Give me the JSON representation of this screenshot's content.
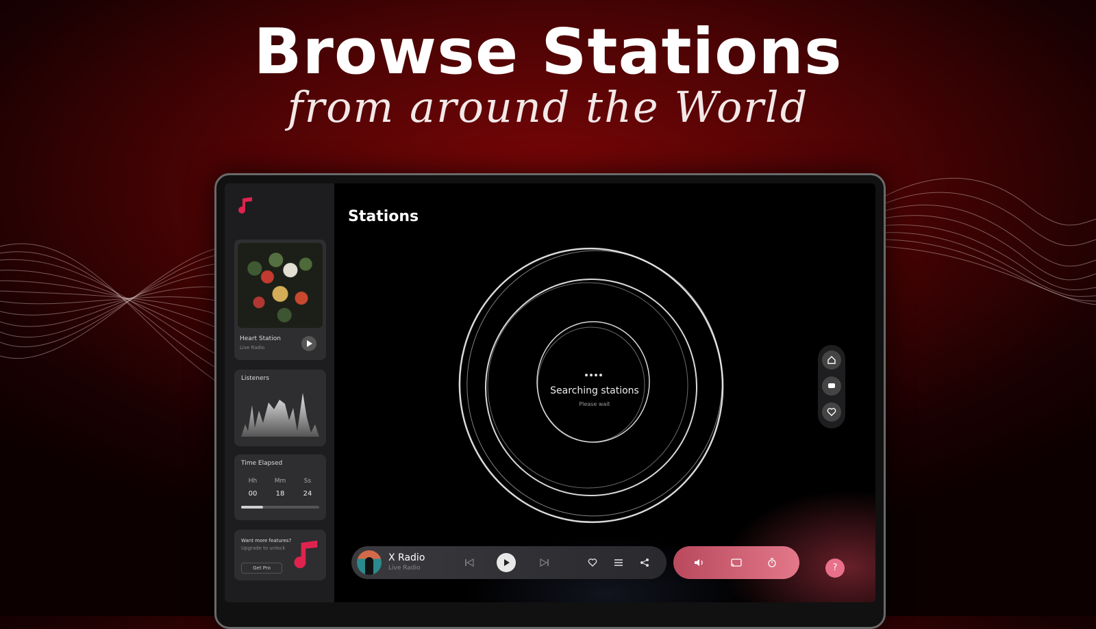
{
  "hero": {
    "title": "Browse Stations",
    "subtitle": "from around the World"
  },
  "app": {
    "page_title": "Stations",
    "now_playing_card": {
      "station": "Heart Station",
      "subtitle": "Live Radio"
    },
    "listeners_card": {
      "title": "Listeners"
    },
    "time_card": {
      "title": "Time Elapsed",
      "labels": [
        "Hh",
        "Mm",
        "Ss"
      ],
      "values": [
        "00",
        "18",
        "24"
      ],
      "progress": 0.28
    },
    "upgrade_card": {
      "title": "Want more features?",
      "subtitle": "Upgrade to unlock",
      "button": "Get Pro"
    },
    "search": {
      "title": "Searching stations",
      "subtitle": "Please wait"
    },
    "player": {
      "station": "X Radio",
      "subtitle": "Live Radio"
    },
    "help_label": "?",
    "colors": {
      "accent": "#e0234e",
      "player_gradient_start": "#b9495d",
      "player_gradient_end": "#e3788b"
    }
  }
}
